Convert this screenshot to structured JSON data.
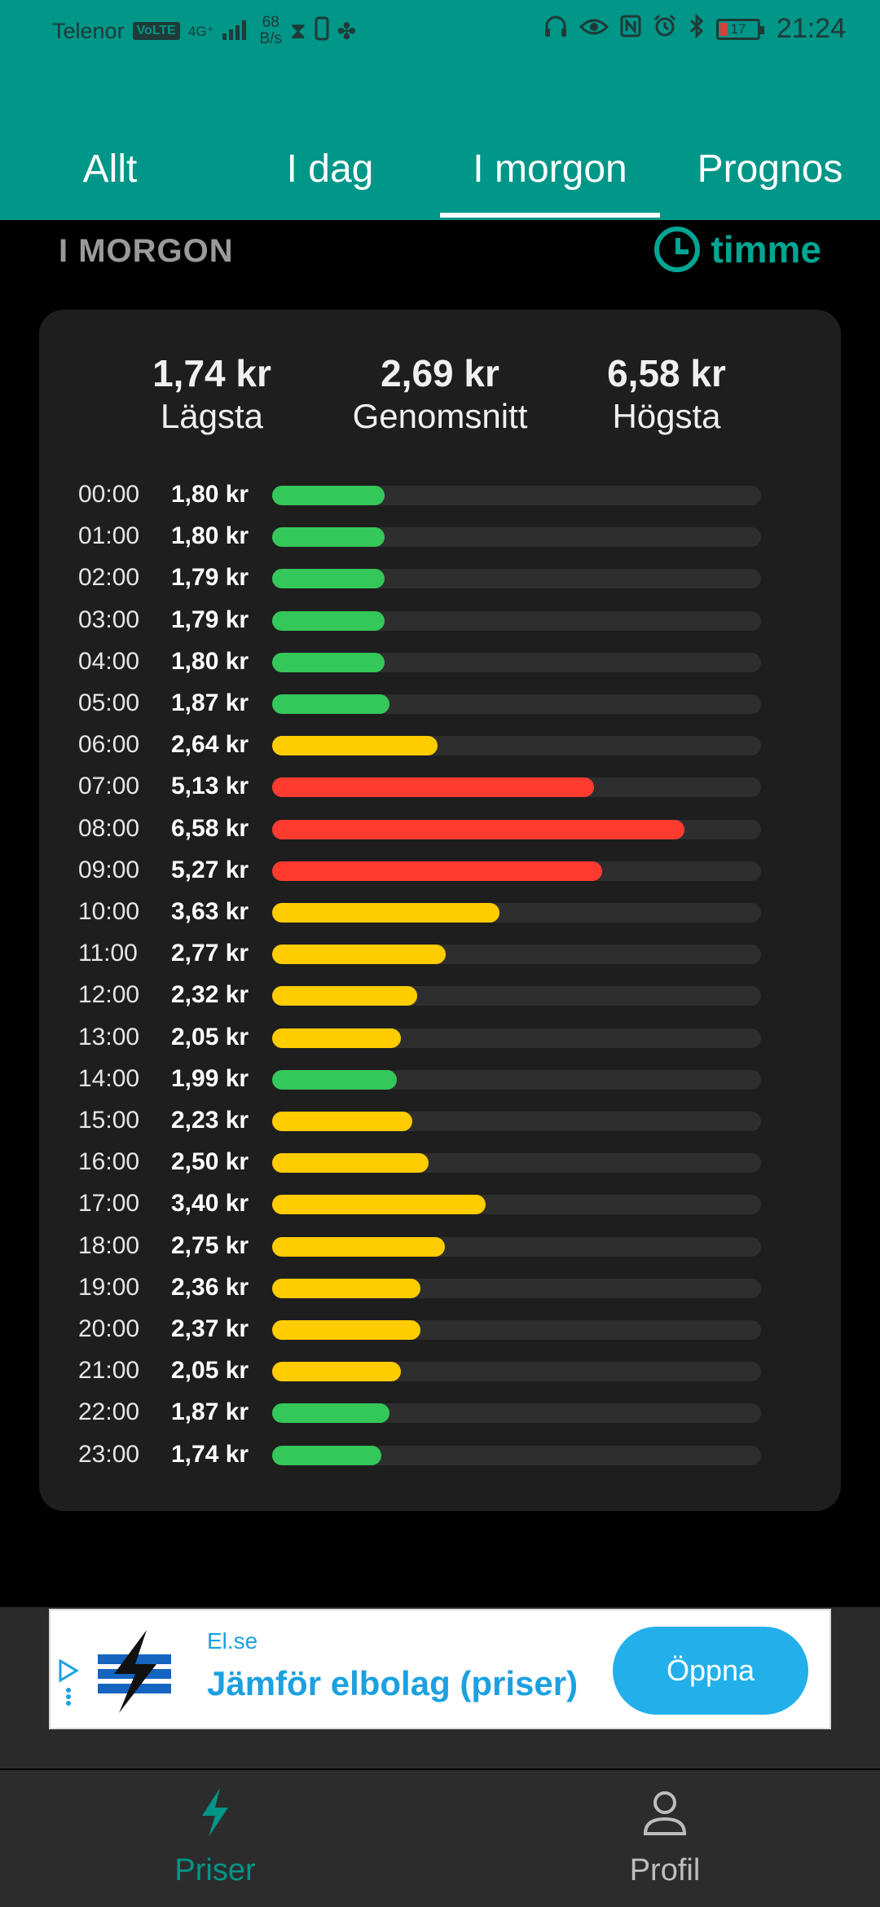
{
  "status_bar": {
    "carrier": "Telenor",
    "volte": "VoLTE",
    "network": "4G⁺",
    "speed_value": "68",
    "speed_unit": "B/s",
    "battery_level": "17",
    "time": "21:24"
  },
  "tabs": [
    {
      "label": "Allt",
      "active": false
    },
    {
      "label": "I dag",
      "active": false
    },
    {
      "label": "I morgon",
      "active": true
    },
    {
      "label": "Prognos",
      "active": false
    }
  ],
  "section": {
    "title": "I MORGON",
    "mode_label": "timme"
  },
  "summary": {
    "lowest": {
      "value": "1,74 kr",
      "label": "Lägsta"
    },
    "average": {
      "value": "2,69 kr",
      "label": "Genomsnitt"
    },
    "highest": {
      "value": "6,58 kr",
      "label": "Högsta"
    }
  },
  "colors": {
    "low": "#34c759",
    "mid": "#ffcc00",
    "high": "#ff3b30",
    "accent": "#009688"
  },
  "price_scale_max": 7.8,
  "hourly": [
    {
      "hour": "00:00",
      "price_label": "1,80 kr",
      "price": 1.8,
      "level": "low"
    },
    {
      "hour": "01:00",
      "price_label": "1,80 kr",
      "price": 1.8,
      "level": "low"
    },
    {
      "hour": "02:00",
      "price_label": "1,79 kr",
      "price": 1.79,
      "level": "low"
    },
    {
      "hour": "03:00",
      "price_label": "1,79 kr",
      "price": 1.79,
      "level": "low"
    },
    {
      "hour": "04:00",
      "price_label": "1,80 kr",
      "price": 1.8,
      "level": "low"
    },
    {
      "hour": "05:00",
      "price_label": "1,87 kr",
      "price": 1.87,
      "level": "low"
    },
    {
      "hour": "06:00",
      "price_label": "2,64 kr",
      "price": 2.64,
      "level": "mid"
    },
    {
      "hour": "07:00",
      "price_label": "5,13 kr",
      "price": 5.13,
      "level": "high"
    },
    {
      "hour": "08:00",
      "price_label": "6,58 kr",
      "price": 6.58,
      "level": "high"
    },
    {
      "hour": "09:00",
      "price_label": "5,27 kr",
      "price": 5.27,
      "level": "high"
    },
    {
      "hour": "10:00",
      "price_label": "3,63 kr",
      "price": 3.63,
      "level": "mid"
    },
    {
      "hour": "11:00",
      "price_label": "2,77 kr",
      "price": 2.77,
      "level": "mid"
    },
    {
      "hour": "12:00",
      "price_label": "2,32 kr",
      "price": 2.32,
      "level": "mid"
    },
    {
      "hour": "13:00",
      "price_label": "2,05 kr",
      "price": 2.05,
      "level": "mid"
    },
    {
      "hour": "14:00",
      "price_label": "1,99 kr",
      "price": 1.99,
      "level": "low"
    },
    {
      "hour": "15:00",
      "price_label": "2,23 kr",
      "price": 2.23,
      "level": "mid"
    },
    {
      "hour": "16:00",
      "price_label": "2,50 kr",
      "price": 2.5,
      "level": "mid"
    },
    {
      "hour": "17:00",
      "price_label": "3,40 kr",
      "price": 3.4,
      "level": "mid"
    },
    {
      "hour": "18:00",
      "price_label": "2,75 kr",
      "price": 2.75,
      "level": "mid"
    },
    {
      "hour": "19:00",
      "price_label": "2,36 kr",
      "price": 2.36,
      "level": "mid"
    },
    {
      "hour": "20:00",
      "price_label": "2,37 kr",
      "price": 2.37,
      "level": "mid"
    },
    {
      "hour": "21:00",
      "price_label": "2,05 kr",
      "price": 2.05,
      "level": "mid"
    },
    {
      "hour": "22:00",
      "price_label": "1,87 kr",
      "price": 1.87,
      "level": "low"
    },
    {
      "hour": "23:00",
      "price_label": "1,74 kr",
      "price": 1.74,
      "level": "low"
    }
  ],
  "ad": {
    "source": "El.se",
    "title": "Jämför elbolag (priser)",
    "button": "Öppna"
  },
  "bottom_nav": [
    {
      "label": "Priser",
      "icon": "lightning-icon",
      "active": true
    },
    {
      "label": "Profil",
      "icon": "person-icon",
      "active": false
    }
  ]
}
